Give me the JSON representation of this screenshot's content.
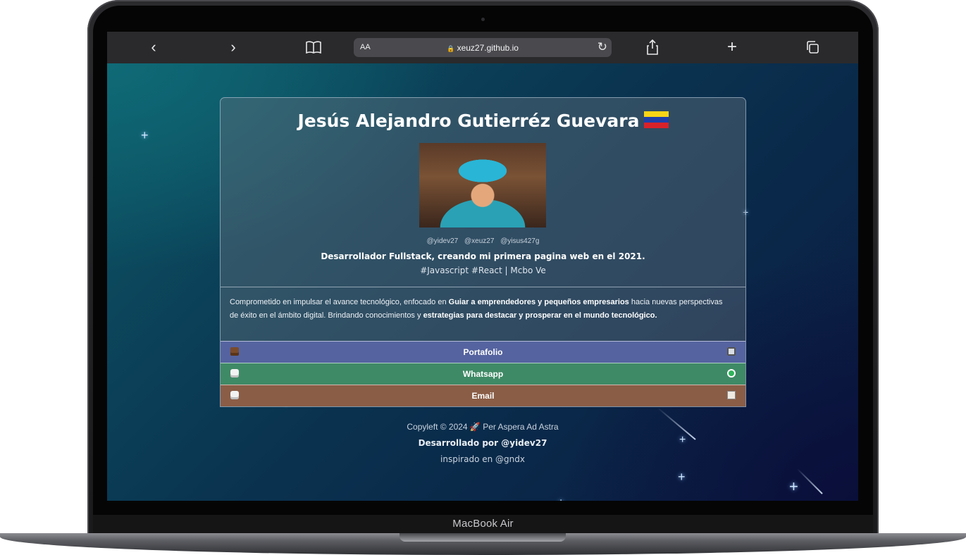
{
  "device": {
    "model_label": "MacBook Air"
  },
  "browser": {
    "text_size_label": "AA",
    "url": "xeuz27.github.io",
    "icons": [
      "back-icon",
      "forward-icon",
      "bookmarks-icon",
      "lock-icon",
      "reload-icon",
      "share-icon",
      "new-tab-icon",
      "tabs-icon"
    ],
    "glyphs": {
      "back": "‹",
      "forward": "›",
      "bookmarks": "📖",
      "lock": "🔒",
      "reload": "↻",
      "share": "⇪",
      "new_tab": "+",
      "tabs": "⧉"
    }
  },
  "profile": {
    "name": "Jesús Alejandro Gutierréz Guevara",
    "flag": "Venezuela flag",
    "handles": [
      "@yidev27",
      "@xeuz27",
      "@yisus427g"
    ],
    "tagline": "Desarrollador Fullstack, creando mi primera pagina web en el 2021.",
    "tags": "#Javascript #React | Mcbo Ve",
    "about": {
      "p1": "Comprometido en impulsar el avance tecnológico, enfocado en ",
      "b1": "Guiar a emprendedores y pequeños empresarios",
      "p2": " hacia nuevas perspectivas de éxito en el ámbito digital. Brindando conocimientos y ",
      "b2": "estrategias para destacar y prosperar en el mundo tecnológico."
    }
  },
  "links": [
    {
      "label": "Portafolio",
      "left_icon": "briefcase-icon",
      "right_icon": "laptop-icon",
      "color": "#5563a0"
    },
    {
      "label": "Whatsapp",
      "left_icon": "chat-icon",
      "right_icon": "whatsapp-icon",
      "color": "#3f8a66"
    },
    {
      "label": "Email",
      "left_icon": "chat-icon",
      "right_icon": "envelope-icon",
      "color": "#8a5d46"
    }
  ],
  "footer": {
    "copyleft": "Copyleft © 2024 🚀 Per Aspera Ad Astra",
    "developed_by": "Desarrollado por @yidev27",
    "inspired_by": "inspirado en @gndx"
  }
}
